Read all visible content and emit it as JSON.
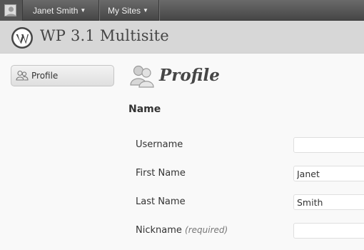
{
  "admin_bar": {
    "user_name": "Janet Smith",
    "my_sites": "My Sites"
  },
  "header": {
    "site_title": "WP 3.1 Multisite"
  },
  "sidebar": {
    "items": [
      {
        "label": "Profile",
        "icon": "users-icon"
      }
    ]
  },
  "page": {
    "title": "Profile",
    "section_heading": "Name",
    "fields": [
      {
        "label": "Username",
        "value": ""
      },
      {
        "label": "First Name",
        "value": "Janet"
      },
      {
        "label": "Last Name",
        "value": "Smith"
      },
      {
        "label": "Nickname",
        "note": "(required)",
        "value": ""
      }
    ]
  },
  "colors": {
    "admin_bar": "#464646",
    "header": "#d7d7d7",
    "background": "#f9f9f9"
  }
}
